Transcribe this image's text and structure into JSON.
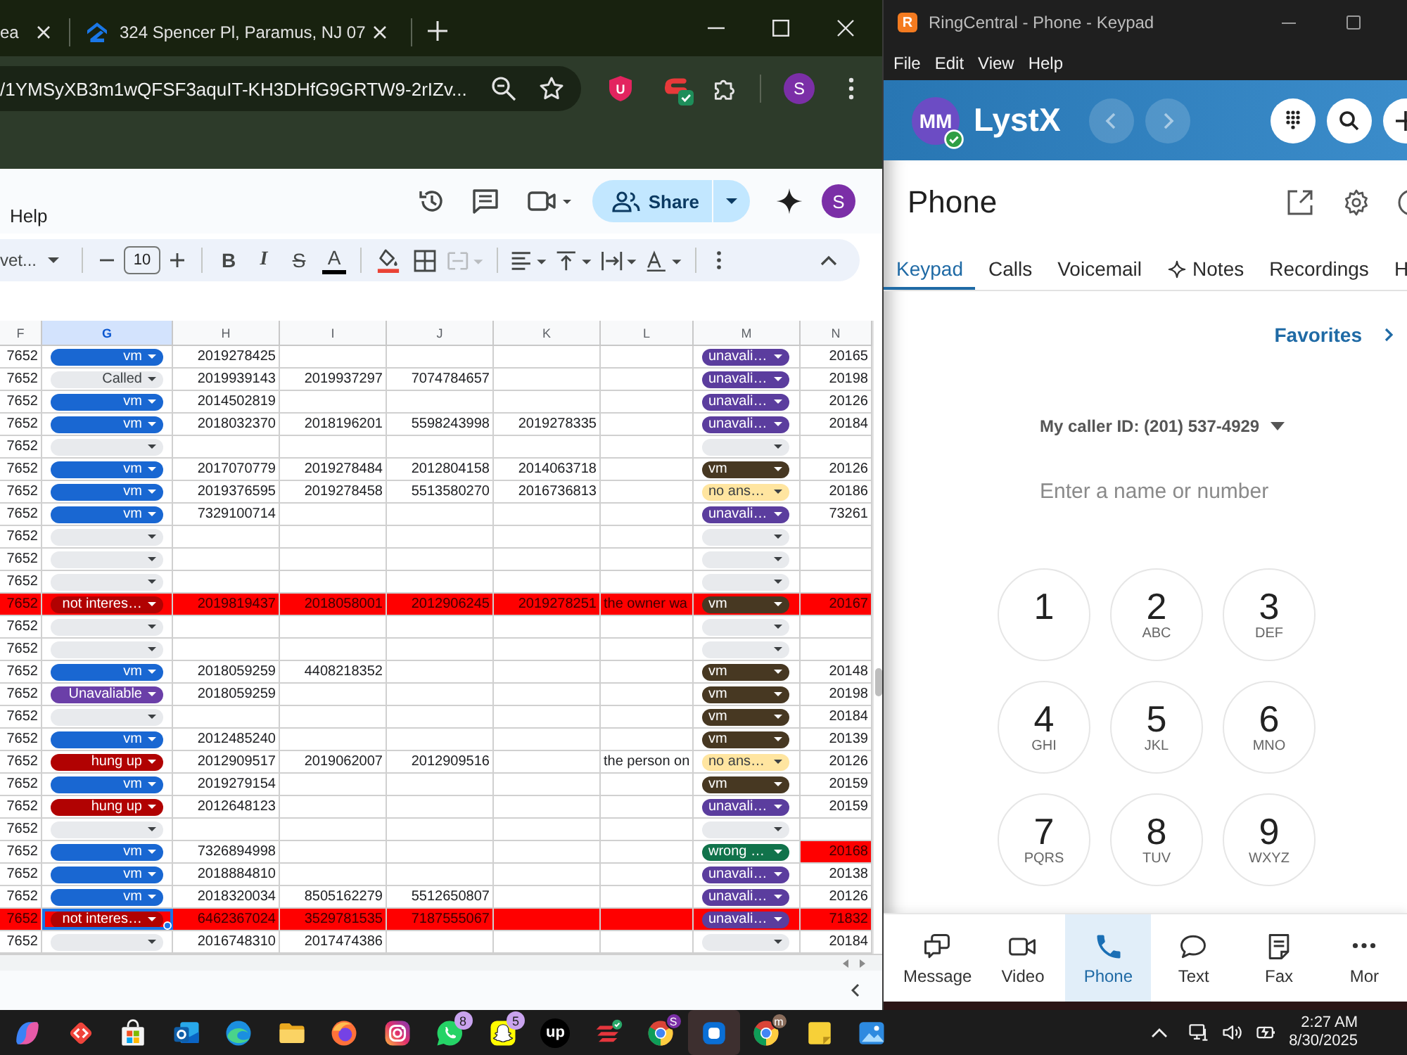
{
  "browser": {
    "tabs": [
      {
        "title": "ea",
        "selected": false
      },
      {
        "title": "324 Spencer Pl, Paramus, NJ 07",
        "selected": false
      }
    ],
    "url": "/1YMSyXB3m1wQFSF3aquIT-KH3DHfG9GRTW9-2rIZv...",
    "shield_letter": "U",
    "profile_initial": "S"
  },
  "sheet": {
    "menu": [
      "Help"
    ],
    "share": "Share",
    "account_initial": "S",
    "toolbar": {
      "font": "vet...",
      "font_size": "10",
      "format": [
        {
          "kind": "bold",
          "glyph": "B"
        },
        {
          "kind": "italic",
          "glyph": "I"
        },
        {
          "kind": "strike",
          "glyph": "S"
        },
        {
          "kind": "color",
          "glyph": "A"
        }
      ],
      "merge_disabled": true
    },
    "columns": [
      {
        "label": "F",
        "selected": false
      },
      {
        "label": "G",
        "selected": true
      },
      {
        "label": "H",
        "selected": false
      },
      {
        "label": "I",
        "selected": false
      },
      {
        "label": "J",
        "selected": false
      },
      {
        "label": "K",
        "selected": false
      },
      {
        "label": "L",
        "selected": false
      },
      {
        "label": "M",
        "selected": false
      },
      {
        "label": "N",
        "selected": false
      }
    ],
    "rows": [
      {
        "f": "7652",
        "g": {
          "label": "vm",
          "color": "#1967d2"
        },
        "h": "2019278425",
        "m": {
          "label": "unavali…",
          "color": "#5b3d9e"
        },
        "n": "20165",
        "highlighted": false,
        "n_highlighted": false,
        "selected": false
      },
      {
        "f": "7652",
        "g": {
          "label": "Called",
          "color": "#e8eaed"
        },
        "h": "2019939143",
        "i": "2019937297",
        "j": "7074784657",
        "m": {
          "label": "unavali…",
          "color": "#5b3d9e"
        },
        "n": "20198",
        "highlighted": false,
        "n_highlighted": false,
        "selected": false
      },
      {
        "f": "7652",
        "g": {
          "label": "vm",
          "color": "#1967d2"
        },
        "h": "2014502819",
        "m": {
          "label": "unavali…",
          "color": "#5b3d9e"
        },
        "n": "20126",
        "highlighted": false,
        "n_highlighted": false,
        "selected": false
      },
      {
        "f": "7652",
        "g": {
          "label": "vm",
          "color": "#1967d2"
        },
        "h": "2018032370",
        "i": "2018196201",
        "j": "5598243998",
        "k": "2019278335",
        "m": {
          "label": "unavali…",
          "color": "#5b3d9e"
        },
        "n": "20184",
        "highlighted": false,
        "n_highlighted": false,
        "selected": false
      },
      {
        "f": "7652",
        "g": {
          "color": "#e8eaed"
        },
        "m": {
          "color": "#e8eaed"
        },
        "highlighted": false,
        "n_highlighted": false,
        "selected": false
      },
      {
        "f": "7652",
        "g": {
          "label": "vm",
          "color": "#1967d2"
        },
        "h": "2017070779",
        "i": "2019278484",
        "j": "2012804158",
        "k": "2014063718",
        "m": {
          "label": "vm",
          "color": "#473822"
        },
        "n": "20126",
        "highlighted": false,
        "n_highlighted": false,
        "selected": false
      },
      {
        "f": "7652",
        "g": {
          "label": "vm",
          "color": "#1967d2"
        },
        "h": "2019376595",
        "i": "2019278458",
        "j": "5513580270",
        "k": "2016736813",
        "m": {
          "label": "no ans…",
          "color": "#ffe5a0"
        },
        "n": "20186",
        "highlighted": false,
        "n_highlighted": false,
        "selected": false
      },
      {
        "f": "7652",
        "g": {
          "label": "vm",
          "color": "#1967d2"
        },
        "h": "7329100714",
        "m": {
          "label": "unavali…",
          "color": "#5b3d9e"
        },
        "n": "73261",
        "highlighted": false,
        "n_highlighted": false,
        "selected": false
      },
      {
        "f": "7652",
        "g": {
          "color": "#e8eaed"
        },
        "m": {
          "color": "#e8eaed"
        },
        "highlighted": false,
        "n_highlighted": false,
        "selected": false
      },
      {
        "f": "7652",
        "g": {
          "color": "#e8eaed"
        },
        "m": {
          "color": "#e8eaed"
        },
        "highlighted": false,
        "n_highlighted": false,
        "selected": false
      },
      {
        "f": "7652",
        "g": {
          "color": "#e8eaed"
        },
        "m": {
          "color": "#e8eaed"
        },
        "highlighted": false,
        "n_highlighted": false,
        "selected": false
      },
      {
        "f": "7652",
        "g": {
          "label": "not interes…",
          "color": "#b10202"
        },
        "h": "2019819437",
        "i": "2018058001",
        "j": "2012906245",
        "k": "2019278251",
        "l": "the owner wa",
        "m": {
          "label": "vm",
          "color": "#473822"
        },
        "n": "20167",
        "highlighted": true,
        "n_highlighted": false,
        "selected": false
      },
      {
        "f": "7652",
        "g": {
          "color": "#e8eaed"
        },
        "m": {
          "color": "#e8eaed"
        },
        "highlighted": false,
        "n_highlighted": false,
        "selected": false
      },
      {
        "f": "7652",
        "g": {
          "color": "#e8eaed"
        },
        "m": {
          "color": "#e8eaed"
        },
        "highlighted": false,
        "n_highlighted": false,
        "selected": false
      },
      {
        "f": "7652",
        "g": {
          "label": "vm",
          "color": "#1967d2"
        },
        "h": "2018059259",
        "i": "4408218352",
        "m": {
          "label": "vm",
          "color": "#473822"
        },
        "n": "20148",
        "highlighted": false,
        "n_highlighted": false,
        "selected": false
      },
      {
        "f": "7652",
        "g": {
          "label": "Unavaliable",
          "color": "#6b3fa8"
        },
        "h": "2018059259",
        "m": {
          "label": "vm",
          "color": "#473822"
        },
        "n": "20198",
        "highlighted": false,
        "n_highlighted": false,
        "selected": false
      },
      {
        "f": "7652",
        "g": {
          "color": "#e8eaed"
        },
        "m": {
          "label": "vm",
          "color": "#473822"
        },
        "n": "20184",
        "highlighted": false,
        "n_highlighted": false,
        "selected": false
      },
      {
        "f": "7652",
        "g": {
          "label": "vm",
          "color": "#1967d2"
        },
        "h": "2012485240",
        "m": {
          "label": "vm",
          "color": "#473822"
        },
        "n": "20139",
        "highlighted": false,
        "n_highlighted": false,
        "selected": false
      },
      {
        "f": "7652",
        "g": {
          "label": "hung up",
          "color": "#b10202"
        },
        "h": "2012909517",
        "i": "2019062007",
        "j": "2012909516",
        "l": "the person on",
        "m": {
          "label": "no ans…",
          "color": "#ffe5a0"
        },
        "n": "20126",
        "highlighted": false,
        "n_highlighted": false,
        "selected": false
      },
      {
        "f": "7652",
        "g": {
          "label": "vm",
          "color": "#1967d2"
        },
        "h": "2019279154",
        "m": {
          "label": "vm",
          "color": "#473822"
        },
        "n": "20159",
        "highlighted": false,
        "n_highlighted": false,
        "selected": false
      },
      {
        "f": "7652",
        "g": {
          "label": "hung up",
          "color": "#b10202"
        },
        "h": "2012648123",
        "m": {
          "label": "unavali…",
          "color": "#5b3d9e"
        },
        "n": "20159",
        "highlighted": false,
        "n_highlighted": false,
        "selected": false
      },
      {
        "f": "7652",
        "g": {
          "color": "#e8eaed"
        },
        "m": {
          "color": "#e8eaed"
        },
        "highlighted": false,
        "n_highlighted": false,
        "selected": false
      },
      {
        "f": "7652",
        "g": {
          "label": "vm",
          "color": "#1967d2"
        },
        "h": "7326894998",
        "m": {
          "label": "wrong …",
          "color": "#11734b"
        },
        "n": "20168",
        "highlighted": false,
        "n_highlighted": true,
        "selected": false
      },
      {
        "f": "7652",
        "g": {
          "label": "vm",
          "color": "#1967d2"
        },
        "h": "2018884810",
        "m": {
          "label": "unavali…",
          "color": "#5b3d9e"
        },
        "n": "20138",
        "highlighted": false,
        "n_highlighted": false,
        "selected": false
      },
      {
        "f": "7652",
        "g": {
          "label": "vm",
          "color": "#1967d2"
        },
        "h": "2018320034",
        "i": "8505162279",
        "j": "5512650807",
        "m": {
          "label": "unavali…",
          "color": "#5b3d9e"
        },
        "n": "20126",
        "highlighted": false,
        "n_highlighted": false,
        "selected": false
      },
      {
        "f": "7652",
        "g": {
          "label": "not interes…",
          "color": "#b10202"
        },
        "h": "6462367024",
        "i": "3529781535",
        "j": "7187555067",
        "m": {
          "label": "unavali…",
          "color": "#5b3d9e"
        },
        "n": "71832",
        "highlighted": true,
        "n_highlighted": false,
        "selected": true
      },
      {
        "f": "7652",
        "g": {
          "color": "#e8eaed"
        },
        "h": "2016748310",
        "i": "2017474386",
        "m": {
          "color": "#e8eaed"
        },
        "n": "20184",
        "highlighted": false,
        "n_highlighted": false,
        "selected": false
      }
    ]
  },
  "ringcentral": {
    "logo_letter": "R",
    "title": "RingCentral - Phone - Keypad",
    "menu": [
      "File",
      "Edit",
      "View",
      "Help"
    ],
    "avatar_initials": "MM",
    "available": true,
    "brand": "LystX",
    "page_title": "Phone",
    "tabs": [
      {
        "label": "Keypad",
        "kind": "plain",
        "selected": true
      },
      {
        "label": "Calls",
        "kind": "plain",
        "selected": false
      },
      {
        "label": "Voicemail",
        "kind": "plain",
        "selected": false
      },
      {
        "label": "Notes",
        "kind": "sparkle",
        "selected": false
      },
      {
        "label": "Recordings",
        "kind": "plain",
        "selected": false
      },
      {
        "label": "H",
        "kind": "plain",
        "selected": false
      }
    ],
    "favorites": "Favorites",
    "caller_id": "My caller ID: (201) 537-4929",
    "search_placeholder": "Enter a name or number",
    "keys": [
      {
        "digit": "1"
      },
      {
        "digit": "2",
        "letters": "ABC"
      },
      {
        "digit": "3",
        "letters": "DEF"
      },
      {
        "digit": "4",
        "letters": "GHI"
      },
      {
        "digit": "5",
        "letters": "JKL"
      },
      {
        "digit": "6",
        "letters": "MNO"
      },
      {
        "digit": "7",
        "letters": "PQRS"
      },
      {
        "digit": "8",
        "letters": "TUV"
      },
      {
        "digit": "9",
        "letters": "WXYZ"
      }
    ],
    "nav": [
      {
        "label": "Message",
        "selected": false
      },
      {
        "label": "Video",
        "selected": false
      },
      {
        "label": "Phone",
        "selected": true
      },
      {
        "label": "Text",
        "selected": false
      },
      {
        "label": "Fax",
        "selected": false
      },
      {
        "label": "Mor",
        "selected": false
      }
    ]
  },
  "taskbar": {
    "apps": [
      {
        "active": false
      },
      {
        "active": false
      },
      {
        "active": false
      },
      {
        "active": false
      },
      {
        "active": false
      },
      {
        "active": false
      },
      {
        "active": false
      },
      {
        "active": false
      },
      {
        "active": false,
        "badge": {
          "kind": "count",
          "text": "8",
          "color": "#c9a3ef"
        }
      },
      {
        "active": false,
        "badge": {
          "kind": "count",
          "text": "5",
          "color": "#c9a3ef"
        }
      },
      {
        "active": false,
        "logo_text": "up"
      },
      {
        "active": false
      },
      {
        "active": false,
        "badge": {
          "kind": "profile",
          "text": "S",
          "color": "#7b2fa7"
        }
      },
      {
        "active": true
      },
      {
        "active": false,
        "badge": {
          "kind": "profile",
          "text": "m",
          "color": "#8a6d5c"
        }
      },
      {
        "active": false
      },
      {
        "active": false
      }
    ],
    "time": "2:27 AM",
    "date": "8/30/2025"
  }
}
